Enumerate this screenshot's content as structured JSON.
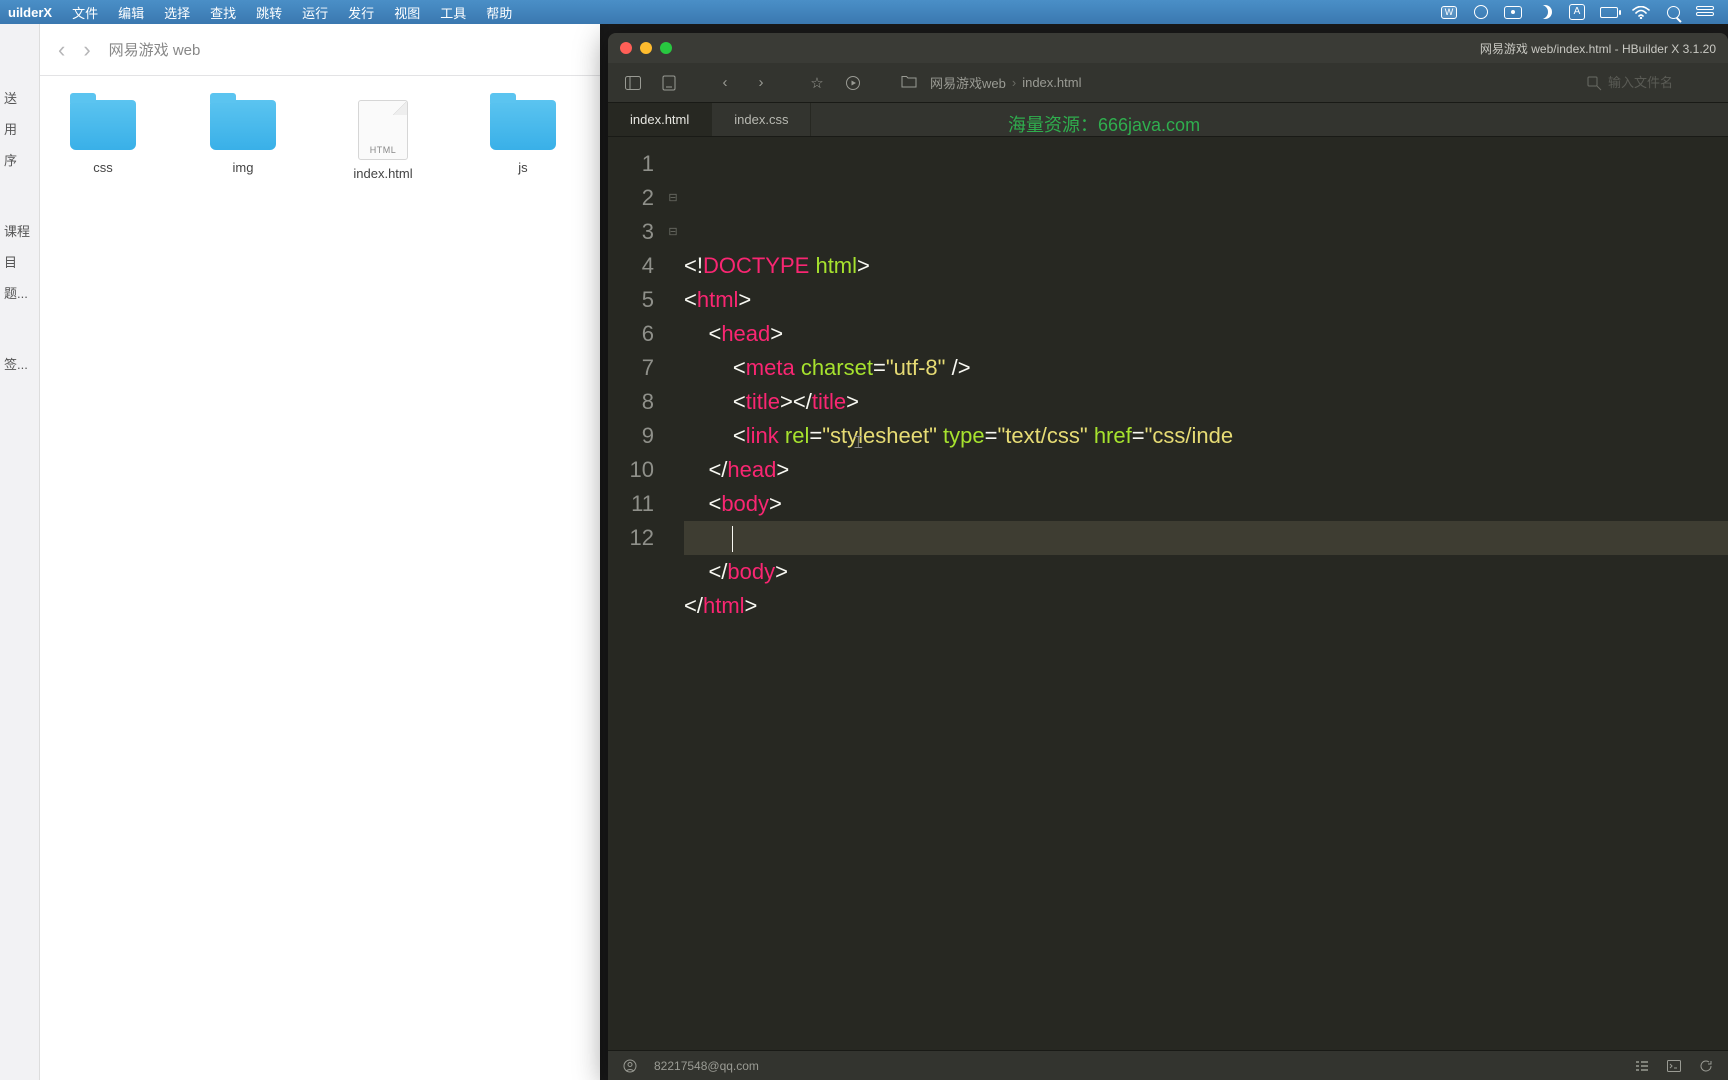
{
  "menubar": {
    "app": "uilderX",
    "items": [
      "文件",
      "编辑",
      "选择",
      "查找",
      "跳转",
      "运行",
      "发行",
      "视图",
      "工具",
      "帮助"
    ],
    "tray_letter": "A"
  },
  "finder": {
    "title": "网易游戏 web",
    "sidebar_groups": [
      [
        "送",
        "用",
        "序"
      ],
      [
        "课程",
        "目",
        "题..."
      ],
      [
        "签..."
      ]
    ],
    "items": [
      {
        "name": "css",
        "type": "folder"
      },
      {
        "name": "img",
        "type": "folder"
      },
      {
        "name": "index.html",
        "type": "file",
        "ftype": "HTML"
      },
      {
        "name": "js",
        "type": "folder"
      }
    ]
  },
  "editor": {
    "window_title": "网易游戏 web/index.html - HBuilder X 3.1.20",
    "breadcrumb": [
      "网易游戏web",
      "index.html"
    ],
    "search_placeholder": "输入文件名",
    "watermark": "海量资源：666java.com",
    "tabs": [
      {
        "label": "index.html",
        "active": true
      },
      {
        "label": "index.css",
        "active": false
      }
    ],
    "code": {
      "lines": [
        {
          "n": 1,
          "html": "<span class='c-brak'>&lt;!</span><span class='c-doctype'>DOCTYPE</span> <span class='c-attr'>html</span><span class='c-brak'>&gt;</span>"
        },
        {
          "n": 2,
          "fold": "⊟",
          "html": "<span class='c-brak'>&lt;</span><span class='c-tag'>html</span><span class='c-brak'>&gt;</span>"
        },
        {
          "n": 3,
          "fold": "⊟",
          "html": "    <span class='c-brak'>&lt;</span><span class='c-tag'>head</span><span class='c-brak'>&gt;</span>"
        },
        {
          "n": 4,
          "html": "        <span class='c-brak'>&lt;</span><span class='c-tag'>meta</span> <span class='c-attr'>charset</span><span class='c-punc'>=</span><span class='c-str'>\"utf-8\"</span> <span class='c-brak'>/&gt;</span>"
        },
        {
          "n": 5,
          "html": "        <span class='c-brak'>&lt;</span><span class='c-tag'>title</span><span class='c-brak'>&gt;&lt;/</span><span class='c-tag'>title</span><span class='c-brak'>&gt;</span>"
        },
        {
          "n": 6,
          "html": "        <span class='c-brak'>&lt;</span><span class='c-tag'>link</span> <span class='c-attr'>rel</span><span class='c-punc'>=</span><span class='c-str'>\"stylesheet\"</span> <span class='c-attr'>type</span><span class='c-punc'>=</span><span class='c-str'>\"text/css\"</span> <span class='c-attr'>href</span><span class='c-punc'>=</span><span class='c-str'>\"css/inde</span>"
        },
        {
          "n": 7,
          "html": "    <span class='c-brak'>&lt;/</span><span class='c-tag'>head</span><span class='c-brak'>&gt;</span>"
        },
        {
          "n": 8,
          "html": "    <span class='c-brak'>&lt;</span><span class='c-tag'>body</span><span class='c-brak'>&gt;</span>"
        },
        {
          "n": 9,
          "hl": true,
          "html": "        <span class='cursor'></span>"
        },
        {
          "n": 10,
          "html": "    <span class='c-brak'>&lt;/</span><span class='c-tag'>body</span><span class='c-brak'>&gt;</span>"
        },
        {
          "n": 11,
          "html": "<span class='c-brak'>&lt;/</span><span class='c-tag'>html</span><span class='c-brak'>&gt;</span>"
        },
        {
          "n": 12,
          "html": ""
        }
      ]
    },
    "status": {
      "user": "82217548@qq.com"
    }
  }
}
